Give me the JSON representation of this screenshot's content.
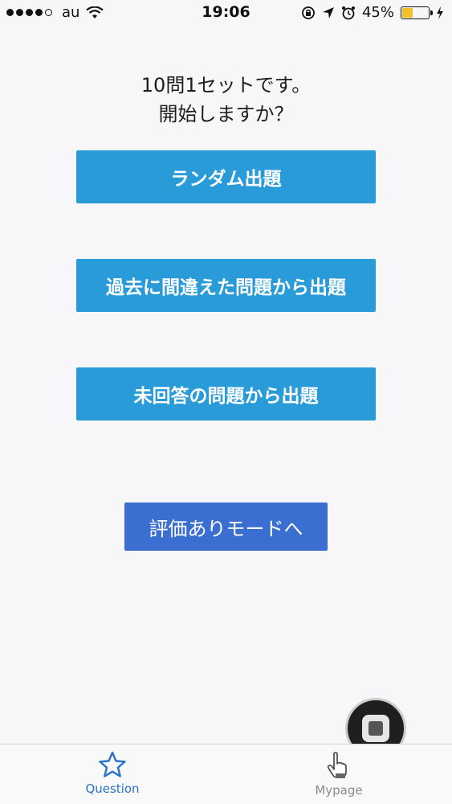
{
  "status_bar": {
    "carrier": "au",
    "time": "19:06",
    "battery_percent": "45%",
    "battery_level": 0.45,
    "battery_color": "#f3c02b"
  },
  "prompt": {
    "line1": "10問1セットです。",
    "line2": "開始しますか？"
  },
  "buttons": {
    "random": "ランダム出題",
    "past_mistakes": "過去に間違えた問題から出題",
    "unanswered": "未回答の問題から出題",
    "evaluation_mode": "評価ありモードへ"
  },
  "tab_bar": {
    "question_label": "Question",
    "mypage_label": "Mypage"
  },
  "colors": {
    "primary_button": "#2a9bd9",
    "secondary_button": "#3a6fd1",
    "tab_active": "#2a72c9",
    "tab_inactive": "#8a8a8a"
  }
}
